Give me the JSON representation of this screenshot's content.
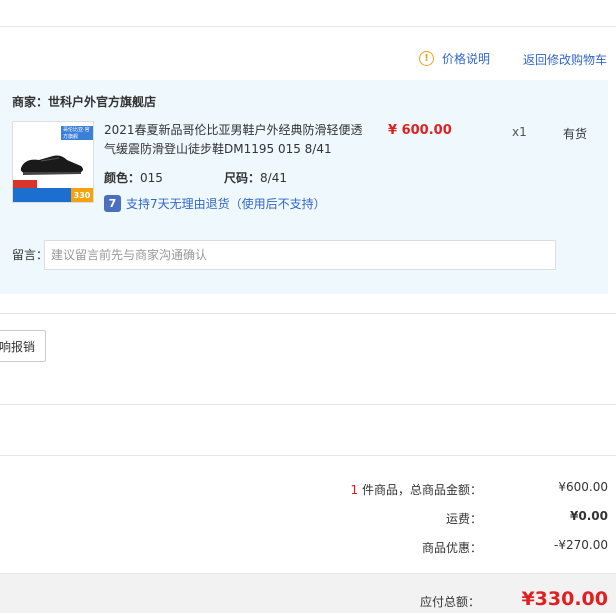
{
  "header": {
    "price_info_label": "价格说明",
    "back_to_cart_label": "返回修改购物车"
  },
  "order": {
    "shop_name": "商家：世科户外官方旗舰店",
    "product": {
      "title": "2021春夏新品哥伦比亚男鞋户外经典防滑轻便透气缓震防滑登山徒步鞋DM1195 015 8/41",
      "unit_price": "¥ 600.00",
      "quantity": "x1",
      "stock": "有货",
      "color_label": "颜色：",
      "color_value": "015",
      "size_label": "尺码：",
      "size_value": "8/41",
      "thumb_price": "330",
      "thumb_badge": "哥伦比亚·官方旗舰"
    },
    "return_policy": "支持7天无理由退货（使用后不支持）",
    "return_icon": "7",
    "message_label": "留言：",
    "message_placeholder": "建议留言前先与商家沟通确认"
  },
  "invoice_button": "响报销",
  "summary": {
    "count": "1",
    "goods_total_label": " 件商品，总商品金额：",
    "goods_total_value": "¥600.00",
    "shipping_label": "运费：",
    "shipping_value": "¥0.00",
    "discount_label": "商品优惠：",
    "discount_value": "-¥270.00"
  },
  "footer": {
    "payable_label": "应付总额：",
    "payable_value": "¥330.00"
  },
  "colors": {
    "accent_red": "#e02020",
    "link_blue": "#3366cc",
    "panel_bg": "#eff8fd",
    "warn_orange": "#f0a020"
  },
  "icons": {
    "price_info": "warning-circle-icon",
    "return_policy": "seven-day-return-icon"
  }
}
